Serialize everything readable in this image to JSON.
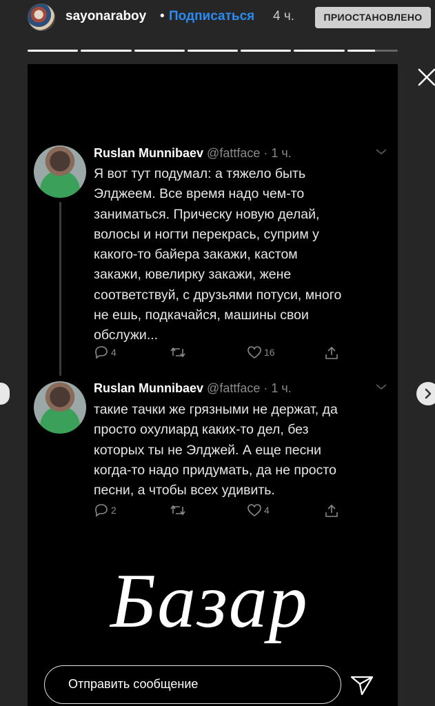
{
  "header": {
    "username": "sayonaraboy",
    "separator": "•",
    "subscribe_label": "Подписаться",
    "time_ago": "4 ч.",
    "status_badge": "ПРИОСТАНОВЛЕНО",
    "progress_segments_total": 7,
    "current_segment_fraction": 0.55
  },
  "tweets": [
    {
      "name": "Ruslan Munnibaev",
      "handle_time": "@fattface · 1 ч.",
      "lines": [
        "Я вот тут подумал: а тяжело быть",
        "Элджеем. Все время надо чем-то",
        "заниматься. Прическу новую делай,",
        "волосы и ногти перекрась, суприм у",
        "какого-то байера закажи, кастом",
        "закажи, ювелирку закажи, жене",
        "соответствуй, с друзьями потуси, много",
        "не ешь, подкачайся, машины свои",
        "обслужи..."
      ],
      "replies": "4",
      "retweets": "",
      "likes": "16"
    },
    {
      "name": "Ruslan Munnibaev",
      "handle_time": "@fattface · 1 ч.",
      "lines": [
        "такие тачки же грязными не держат, да",
        "просто охулиард каких-то дел, без",
        "которых ты не Элджей. А еще песни",
        "когда-то надо придумать, да не просто",
        "песни, а чтобы всех удивить."
      ],
      "replies": "2",
      "retweets": "",
      "likes": "4"
    }
  ],
  "sticker_text": "Базар",
  "message": {
    "placeholder": "Отправить сообщение"
  },
  "icons": {
    "close": "close-icon",
    "send": "send-icon",
    "prev": "chevron-left-icon",
    "next": "chevron-right-icon"
  },
  "colors": {
    "background": "#262626",
    "story_bg": "#000000",
    "link": "#2a8bf2",
    "badge_bg": "#d0d0d0",
    "muted": "#8a8a8a"
  }
}
